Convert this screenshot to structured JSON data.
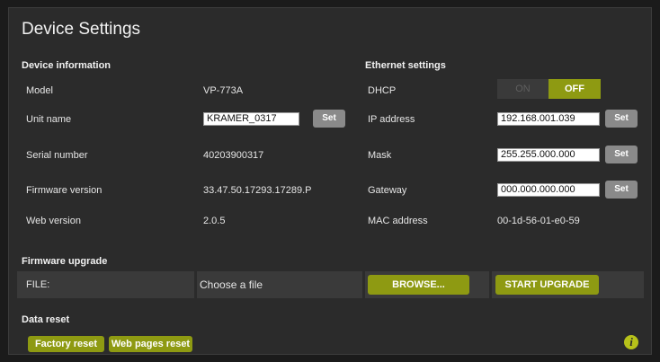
{
  "title": "Device Settings",
  "device_info": {
    "section_title": "Device information",
    "model_label": "Model",
    "model_value": "VP-773A",
    "unit_name_label": "Unit name",
    "unit_name_value": "KRAMER_0317",
    "serial_label": "Serial number",
    "serial_value": "40203900317",
    "firmware_label": "Firmware version",
    "firmware_value": "33.47.50.17293.17289.P",
    "web_label": "Web version",
    "web_value": "2.0.5"
  },
  "ethernet": {
    "section_title": "Ethernet settings",
    "dhcp_label": "DHCP",
    "dhcp_on": "ON",
    "dhcp_off": "OFF",
    "dhcp_state": "OFF",
    "ip_label": "IP address",
    "ip_value": "192.168.001.039",
    "mask_label": "Mask",
    "mask_value": "255.255.000.000",
    "gateway_label": "Gateway",
    "gateway_value": "000.000.000.000",
    "mac_label": "MAC address",
    "mac_value": "00-1d-56-01-e0-59"
  },
  "set_label": "Set",
  "firmware_upgrade": {
    "section_title": "Firmware upgrade",
    "file_label": "FILE:",
    "choose_file": "Choose a file",
    "browse": "BROWSE...",
    "start": "START UPGRADE"
  },
  "data_reset": {
    "section_title": "Data reset",
    "factory_reset": "Factory reset",
    "web_pages_reset": "Web pages reset"
  },
  "colors": {
    "accent": "#8e9a12",
    "background": "#2b2b2b",
    "info": "#b7c21a"
  },
  "icons": {
    "info": "info-icon"
  }
}
